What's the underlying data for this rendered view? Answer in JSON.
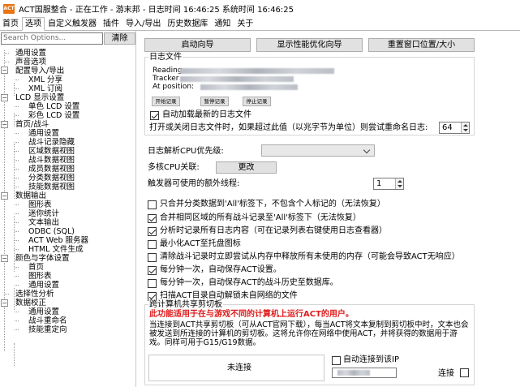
{
  "window": {
    "title": "ACT国服整合 - 正在工作 - 游末邦 - 日志时间 16:46:25 系统时间 16:46:25",
    "icon_text": "ACT"
  },
  "tabs": [
    "首页",
    "选项",
    "自定义触发器",
    "插件",
    "导入/导出",
    "历史数据库",
    "通知",
    "关于"
  ],
  "search": {
    "placeholder": "Search Options...",
    "clear_label": "清除"
  },
  "tree": {
    "n0": "通用设置",
    "n1": "声音选项",
    "n2": "配置导入/导出",
    "n3": "XML 分享",
    "n4": "XML 订阅",
    "n5": "LCD 显示设置",
    "n6": "单色 LCD 设置",
    "n7": "彩色 LCD 设置",
    "n8": "首页/战斗",
    "n9": "通用设置",
    "n10": "战斗记录隐藏",
    "n11": "区域数据视图",
    "n12": "战斗数据视图",
    "n13": "成员数据视图",
    "n14": "分类数据视图",
    "n15": "技能数据视图",
    "n16": "数据输出",
    "n17": "图形表",
    "n18": "迷你统计",
    "n19": "文本输出",
    "n20": "ODBC (SQL)",
    "n21": "ACT Web 服务器",
    "n22": "HTML 文件生成",
    "n23": "颜色与字体设置",
    "n24": "首页",
    "n25": "图形表",
    "n26": "通用设置",
    "n27": "选择性分析",
    "n28": "数据校正",
    "n29": "通用设置",
    "n30": "战斗重命名",
    "n31": "技能重定向"
  },
  "buttons": {
    "startup_wizard": "启动向导",
    "perf_wizard": "显示性能优化向导",
    "reset_window": "重置窗口位置/大小"
  },
  "logfile": {
    "group_title": "日志文件",
    "reading_label": "Reading",
    "tracker_label": "Tracker",
    "position_label": "At position:",
    "btn_open": "开始记录",
    "btn_pause": "暂停记录",
    "btn_stop": "停止记录",
    "auto_load": "自动加载最新的日志文件",
    "rename_label": "打开或关闭日志文件时，如果超过此值（以兆字节为单位）则尝试重命名日志:",
    "rename_value": "64"
  },
  "cpu": {
    "priority_label": "日志解析CPU优先级:",
    "affinity_label": "多核CPU关联:",
    "affinity_btn": "更改",
    "threads_label": "触发器可使用的额外线程:",
    "threads_value": "1"
  },
  "options": [
    {
      "label": "只合并分类数据到'All'标签下，不包含个人标记的（无法恢复）",
      "checked": false
    },
    {
      "label": "合并相同区域的所有战斗记录至'All'标签下（无法恢复）",
      "checked": true
    },
    {
      "label": "分析时记录所有日志内容（可在记录列表右键使用日志查看器）",
      "checked": true
    },
    {
      "label": "最小化ACT至托盘图标",
      "checked": false
    },
    {
      "label": "清除战斗记录时立即尝试从内存中释放所有未使用的内存（可能会导致ACT无响应）",
      "checked": false
    },
    {
      "label": "每分钟一次，自动保存ACT设置。",
      "checked": true
    },
    {
      "label": "每分钟一次，自动保存ACT的战斗历史至数据库。",
      "checked": false
    },
    {
      "label": "扫描ACT目录自动解锁未自网络的文件",
      "checked": true
    }
  ],
  "clipboard": {
    "group_title": "跨计算机共享剪切板",
    "warning": "此功能适用于在与游戏不同的计算机上运行ACT的用户。",
    "description": "当连接到ACT共享剪切板（可从ACT官网下载），每当ACT将文本复制到剪切板中时，文本也会被发送到所连接的计算机的剪切板。这将允许你在网络中使用ACT，并将获得的数据用于游戏。同样可用于G15/G19数据。",
    "status": "未连接",
    "auto_connect": "自动连接到该IP",
    "connect_label": "连接"
  },
  "colors": {
    "warning": "#e01b1b",
    "app_icon": "#e87510"
  }
}
